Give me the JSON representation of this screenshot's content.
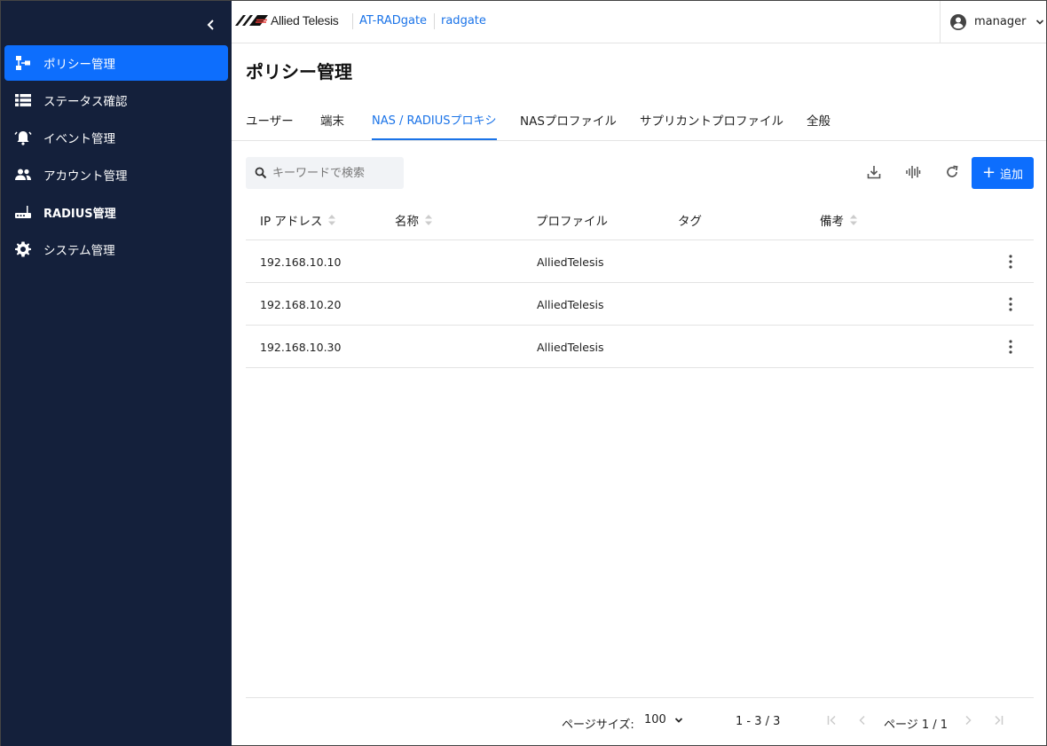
{
  "header": {
    "brand": "Allied Telesis",
    "product_link": "AT-RADgate",
    "host_link": "radgate",
    "user": "manager"
  },
  "sidebar": {
    "items": [
      {
        "label": "ポリシー管理",
        "icon": "policy-tree-icon",
        "active": true
      },
      {
        "label": "ステータス確認",
        "icon": "list-icon"
      },
      {
        "label": "イベント管理",
        "icon": "alarm-bell-icon"
      },
      {
        "label": "アカウント管理",
        "icon": "people-icon"
      },
      {
        "label": "RADIUS管理",
        "icon": "router-icon"
      },
      {
        "label": "システム管理",
        "icon": "gear-icon"
      }
    ]
  },
  "main": {
    "title": "ポリシー管理",
    "tabs": [
      {
        "label": "ユーザー"
      },
      {
        "label": "端末"
      },
      {
        "label": "NAS / RADIUSプロキシ",
        "active": true
      },
      {
        "label": "NASプロファイル"
      },
      {
        "label": "サプリカントプロファイル"
      },
      {
        "label": "全般"
      }
    ],
    "search": {
      "placeholder": "キーワードで検索",
      "value": ""
    },
    "add_label": "追加",
    "columns": [
      "IP アドレス",
      "名称",
      "プロファイル",
      "タグ",
      "備考"
    ],
    "rows": [
      {
        "ip": "192.168.10.10",
        "name": "",
        "profile": "AlliedTelesis",
        "tag": "",
        "note": ""
      },
      {
        "ip": "192.168.10.20",
        "name": "",
        "profile": "AlliedTelesis",
        "tag": "",
        "note": ""
      },
      {
        "ip": "192.168.10.30",
        "name": "",
        "profile": "AlliedTelesis",
        "tag": "",
        "note": ""
      }
    ]
  },
  "footer": {
    "page_size_label": "ページサイズ:",
    "page_size_value": "100",
    "range": "1 - 3 / 3",
    "page_label": "ページ 1 / 1"
  },
  "colors": {
    "sidebar_bg": "#14203b",
    "accent": "#0d6efd",
    "link": "#1a73e8"
  }
}
